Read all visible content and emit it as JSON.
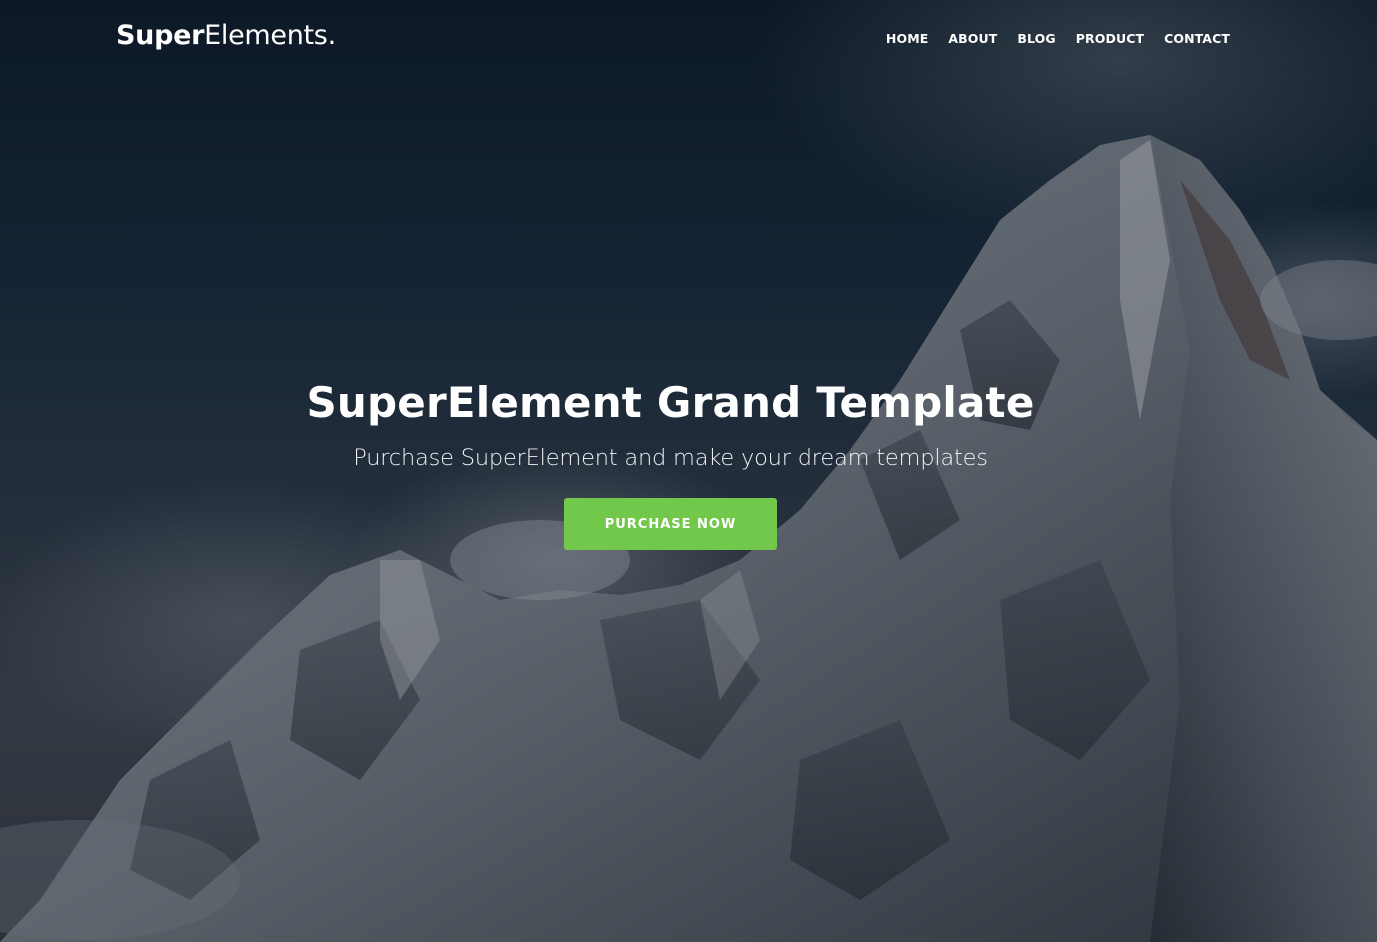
{
  "brand": {
    "name_bold": "Super",
    "name_light": "Elements."
  },
  "nav": {
    "items": [
      {
        "label": "HOME"
      },
      {
        "label": "ABOUT"
      },
      {
        "label": "BLOG"
      },
      {
        "label": "PRODUCT"
      },
      {
        "label": "CONTACT"
      }
    ]
  },
  "hero": {
    "title": "SuperElement Grand Template",
    "subtitle": "Purchase SuperElement and make your dream templates",
    "cta_label": "PURCHASE NOW"
  },
  "colors": {
    "accent": "#72c84a",
    "text": "#ffffff",
    "sky_dark": "#0f1d2c"
  },
  "background": {
    "icon": "snowy-mountain-peak-image"
  }
}
